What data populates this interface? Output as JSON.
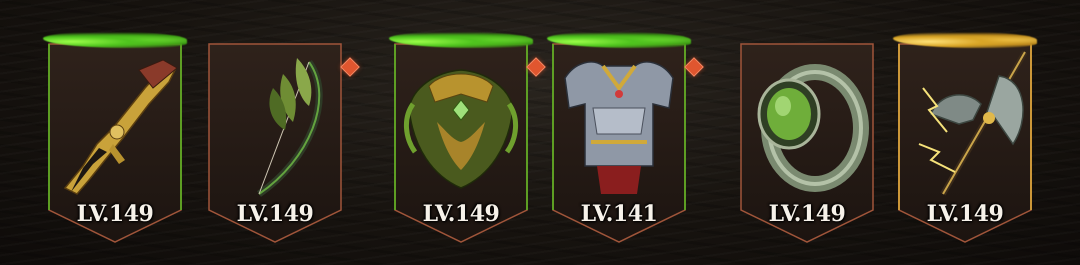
{
  "equipment_slots": [
    {
      "item": "Gilded Flintlock Pistol",
      "icon": "pistol-icon",
      "level_label": "LV.149",
      "rarity": "green",
      "has_notification": false
    },
    {
      "item": "Leafwood Longbow",
      "icon": "bow-icon",
      "level_label": "LV.149",
      "rarity": "none",
      "has_notification": true
    },
    {
      "item": "Verdant Helm",
      "icon": "helmet-icon",
      "level_label": "LV.149",
      "rarity": "green",
      "has_notification": true
    },
    {
      "item": "Plate Chestguard",
      "icon": "chest-armor-icon",
      "level_label": "LV.141",
      "rarity": "green",
      "has_notification": true
    },
    {
      "item": "Jade Ring",
      "icon": "ring-icon",
      "level_label": "LV.149",
      "rarity": "none",
      "has_notification": false
    },
    {
      "item": "Thunder Halberd",
      "icon": "axe-icon",
      "level_label": "LV.149",
      "rarity": "gold",
      "has_notification": false
    }
  ],
  "colors": {
    "frame_border": "#a0553a",
    "slot_fill": "#2a1d17",
    "moss_green": "#6fd12e",
    "moss_gold": "#e6b33c",
    "notification_badge": "#e0562f",
    "level_text": "#f7f2ea"
  }
}
